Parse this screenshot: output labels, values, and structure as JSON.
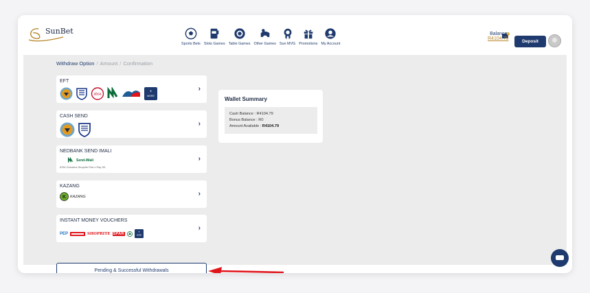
{
  "brand": {
    "name": "SunBet"
  },
  "nav": [
    {
      "label": "Sports Bets",
      "icon": "soccer-ball-icon"
    },
    {
      "label": "Slots Games",
      "icon": "slot-machine-icon"
    },
    {
      "label": "Table Games",
      "icon": "poker-chip-icon"
    },
    {
      "label": "Other Games",
      "icon": "controller-icon"
    },
    {
      "label": "Sun MVG",
      "icon": "medal-icon"
    },
    {
      "label": "Promotions",
      "icon": "gift-icon"
    },
    {
      "label": "My Account",
      "icon": "user-icon"
    }
  ],
  "balance": {
    "label": "Balance:",
    "amount": "R4104.79"
  },
  "deposit_label": "Deposit",
  "breadcrumb": {
    "step1": "Withdraw Option",
    "step2": "Amount",
    "step3": "Confirmation",
    "separator": "/"
  },
  "methods": {
    "eft": {
      "title": "EFT",
      "more_label": "MORE",
      "absa_label": "absa"
    },
    "cash_send": {
      "title": "CASH SEND"
    },
    "nedbank": {
      "title": "NEDBANK SEND IMALI",
      "logo_text": "Send-iMali",
      "partners_text": "ATM/ Checkers Shoprite Pick n Pay OK"
    },
    "kazang": {
      "title": "KAZANG",
      "logo_text": "KAZANG"
    },
    "vouchers": {
      "title": "INSTANT MONEY VOUCHERS",
      "pep": "PEP",
      "shoprite": "SHOPRITE",
      "spar": "SPAR",
      "more_label": "MORE"
    }
  },
  "pending_label": "Pending & Successful Withdrawals",
  "wallet_summary": {
    "title": "Wallet Summary",
    "cash": "Cash Balance : R4104.79",
    "bonus": "Bonus Balance : R0",
    "available_label": "Amount Available : ",
    "available_value": "R4104.79"
  },
  "colors": {
    "primary": "#1f3a6e",
    "accent": "#b8862b",
    "arrow": "#e0151c"
  }
}
